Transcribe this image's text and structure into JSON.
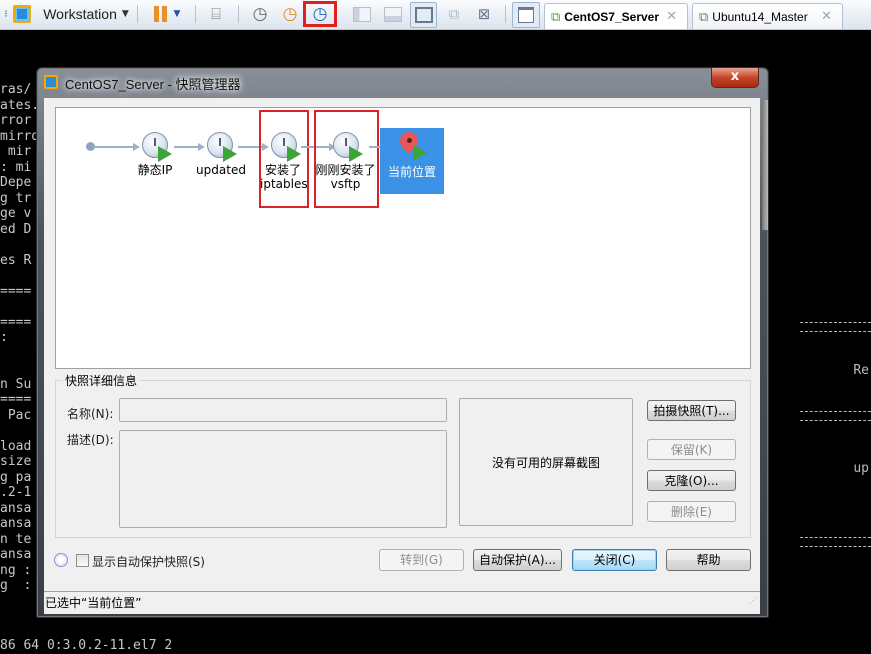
{
  "toolbar": {
    "workstation_label": "Workstation",
    "icons": [
      "workstation-logo-icon",
      "pause-icon",
      "send-ctrl-alt-del-icon",
      "take-snapshot-icon",
      "revert-snapshot-icon",
      "snapshot-manager-icon",
      "console-view-icon",
      "thumbnail-view-icon",
      "fullscreen-icon",
      "unity-icon",
      "exclusive-mode-icon",
      "tab-view-icon"
    ],
    "tabs": [
      {
        "label": "CentOS7_Server",
        "active": true
      },
      {
        "label": "Ubuntu14_Master",
        "active": false
      }
    ]
  },
  "terminal": {
    "left_lines": [
      "ras/",
      "ates.",
      "rror",
      "mirro",
      " mir",
      ": mi",
      "Depe",
      "g tr",
      "ge v",
      "ed D",
      "",
      "es R",
      "",
      "====",
      "",
      "====",
      ":",
      "",
      "",
      "n Su",
      "====",
      " Pac",
      "",
      "load",
      "size",
      "g pa",
      ".2-1",
      "ansa",
      "ansa",
      "n te",
      "ansa",
      "ng :",
      "g  :"
    ],
    "right_lines": [
      "Re",
      "up"
    ],
    "bottom_line": "86 64 0:3.0.2-11.el7 2"
  },
  "dialog": {
    "title": "CentOS7_Server - 快照管理器",
    "close_label": "x",
    "snapshots": [
      {
        "label": "静态IP"
      },
      {
        "label": "updated"
      },
      {
        "label": "安装了\niptables",
        "line1": "安装了",
        "line2": "iptables",
        "highlighted": true
      },
      {
        "label": "刚刚安装了\nvsftp",
        "line1": "刚刚安装了",
        "line2": "vsftp",
        "highlighted": true
      }
    ],
    "current_position_label": "当前位置",
    "details": {
      "group_title": "快照详细信息",
      "name_label": "名称(N):",
      "name_value": "",
      "description_label": "描述(D):",
      "description_value": "",
      "screenshot_placeholder": "没有可用的屏幕截图"
    },
    "side_buttons": {
      "take_snapshot": "拍摄快照(T)...",
      "keep": "保留(K)",
      "clone": "克隆(O)...",
      "delete": "删除(E)"
    },
    "show_autoprotect_label": "显示自动保护快照(S)",
    "show_autoprotect_checked": false,
    "bottom_buttons": {
      "goto": "转到(G)",
      "autoprotect": "自动保护(A)...",
      "close": "关闭(C)",
      "help": "帮助"
    },
    "status": "已选中“当前位置”"
  },
  "colors": {
    "current_position_bg": "#3c92e6",
    "highlight_box": "#d8232a",
    "play_green": "#3ea43a"
  }
}
